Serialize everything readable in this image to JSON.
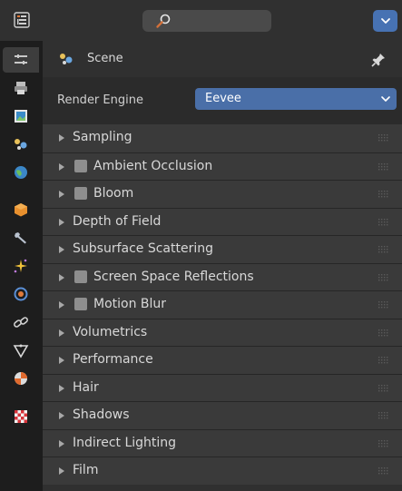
{
  "header": {
    "editor_type_icon": "properties-editor-icon",
    "search": {
      "icon": "search-icon",
      "placeholder": ""
    },
    "options_icon": "chevron-down-icon",
    "accent": "#4772b3"
  },
  "tabs": [
    {
      "name": "tool-tab",
      "icon": "tool-icon"
    },
    {
      "name": "render-tab",
      "icon": "render-camera-icon",
      "active": true
    },
    {
      "name": "output-tab",
      "icon": "printer-icon"
    },
    {
      "name": "view-layer-tab",
      "icon": "image-icon"
    },
    {
      "name": "scene-tab",
      "icon": "scene-icon"
    },
    {
      "name": "world-tab",
      "icon": "world-icon"
    },
    {
      "name": "object-tab",
      "icon": "object-cube-icon"
    },
    {
      "name": "modifiers-tab",
      "icon": "wrench-icon"
    },
    {
      "name": "particles-tab",
      "icon": "particles-icon"
    },
    {
      "name": "physics-tab",
      "icon": "physics-icon"
    },
    {
      "name": "constraints-tab",
      "icon": "constraints-icon"
    },
    {
      "name": "data-tab",
      "icon": "mesh-data-icon"
    },
    {
      "name": "material-tab",
      "icon": "material-icon"
    },
    {
      "name": "texture-tab",
      "icon": "texture-checker-icon"
    }
  ],
  "context": {
    "scene_label": "Scene",
    "scene_icon": "scene-icon",
    "pin_icon": "pin-icon"
  },
  "render_engine": {
    "label": "Render Engine",
    "value": "Eevee"
  },
  "sections": [
    {
      "label": "Sampling",
      "checkbox": false
    },
    {
      "label": "Ambient Occlusion",
      "checkbox": true
    },
    {
      "label": "Bloom",
      "checkbox": true
    },
    {
      "label": "Depth of Field",
      "checkbox": false
    },
    {
      "label": "Subsurface Scattering",
      "checkbox": false
    },
    {
      "label": "Screen Space Reflections",
      "checkbox": true
    },
    {
      "label": "Motion Blur",
      "checkbox": true
    },
    {
      "label": "Volumetrics",
      "checkbox": false
    },
    {
      "label": "Performance",
      "checkbox": false
    },
    {
      "label": "Hair",
      "checkbox": false
    },
    {
      "label": "Shadows",
      "checkbox": false
    },
    {
      "label": "Indirect Lighting",
      "checkbox": false
    },
    {
      "label": "Film",
      "checkbox": false
    }
  ]
}
